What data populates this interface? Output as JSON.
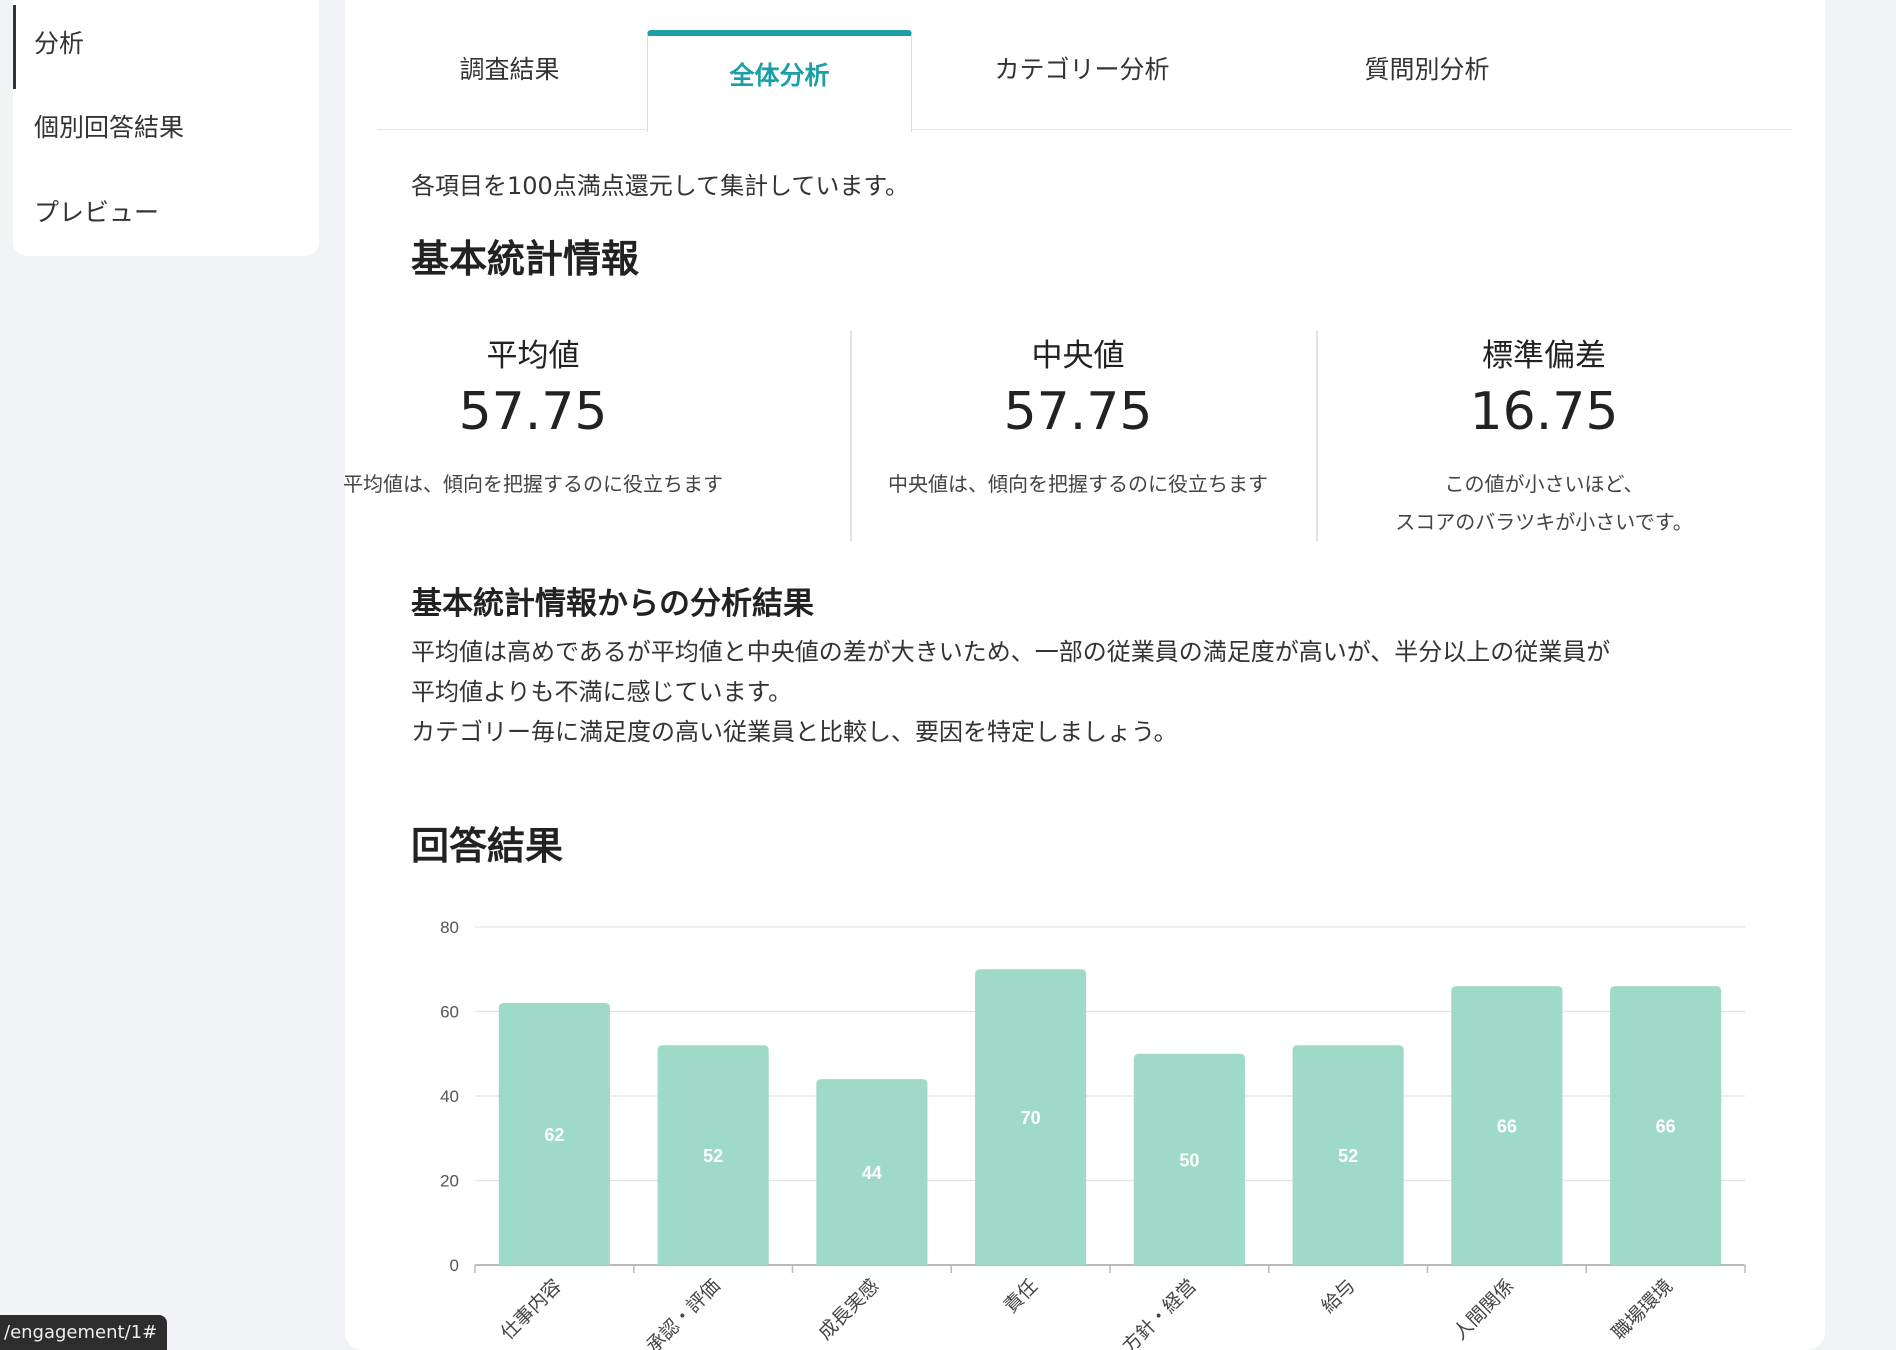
{
  "sidebar": {
    "items": [
      {
        "label": "分析"
      },
      {
        "label": "個別回答結果"
      },
      {
        "label": "プレビュー"
      }
    ]
  },
  "tabs": [
    {
      "label": "調査結果"
    },
    {
      "label": "全体分析"
    },
    {
      "label": "カテゴリー分析"
    },
    {
      "label": "質問別分析"
    }
  ],
  "main": {
    "note": "各項目を100点満点還元して集計しています。",
    "basic_title": "基本統計情報",
    "stats": [
      {
        "label": "平均値",
        "value": "57.75",
        "desc": "平均値は、傾向を把握するのに役立ちます"
      },
      {
        "label": "中央値",
        "value": "57.75",
        "desc": "中央値は、傾向を把握するのに役立ちます"
      },
      {
        "label": "標準偏差",
        "value": "16.75",
        "desc_line1": "この値が小さいほど、",
        "desc_line2": "スコアのバラツキが小さいです。"
      }
    ],
    "analysis_title": "基本統計情報からの分析結果",
    "analysis_line1": "平均値は高めであるが平均値と中央値の差が大きいため、一部の従業員の満足度が高いが、半分以上の従業員が",
    "analysis_line2": "平均値よりも不満に感じています。",
    "analysis_line3": "カテゴリー毎に満足度の高い従業員と比較し、要因を特定しましょう。",
    "results_title": "回答結果"
  },
  "status_url": "/engagement/1#",
  "colors": {
    "accent": "#1a9fa8",
    "bar": "#9fdac9"
  },
  "chart_data": {
    "type": "bar",
    "categories": [
      "仕事内容",
      "承認・評価",
      "成長実感",
      "責任",
      "方針・経営",
      "給与",
      "人間関係",
      "職場環境"
    ],
    "values": [
      62,
      52,
      44,
      70,
      50,
      52,
      66,
      66
    ],
    "yticks": [
      "0",
      "20",
      "40",
      "60",
      "80"
    ],
    "ylim": [
      0,
      80
    ],
    "grid": true,
    "data_labels": true
  }
}
